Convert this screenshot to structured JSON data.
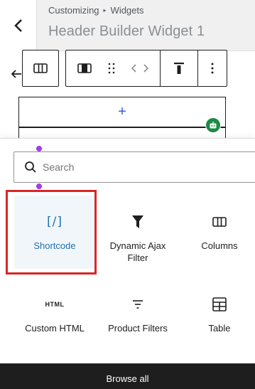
{
  "header": {
    "breadcrumb_root": "Customizing",
    "breadcrumb_sep": "▸",
    "breadcrumb_current": "Widgets",
    "title": "Header Builder Widget 1"
  },
  "toolbar": {
    "buttons": [
      "columns-icon",
      "column-icon",
      "drag-handle-icon",
      "code-arrows-icon",
      "align-top-icon",
      "more-options-icon"
    ]
  },
  "editor": {
    "add_symbol": "+"
  },
  "inserter": {
    "search_placeholder": "Search",
    "blocks": [
      {
        "label": "Shortcode",
        "icon": "shortcode-icon",
        "icon_text": "[/]",
        "selected": true
      },
      {
        "label": "Dynamic Ajax Filter",
        "icon": "funnel-icon"
      },
      {
        "label": "Columns",
        "icon": "columns-icon"
      },
      {
        "label": "Custom HTML",
        "icon": "html-icon",
        "icon_text": "HTML"
      },
      {
        "label": "Product Filters",
        "icon": "filter-lines-icon"
      },
      {
        "label": "Table",
        "icon": "table-icon"
      }
    ],
    "browse_all_label": "Browse all"
  },
  "colors": {
    "accent": "#2271b1",
    "highlight": "#d92626",
    "badge": "#1e8a44",
    "browse_bg": "#1e1e1e"
  }
}
